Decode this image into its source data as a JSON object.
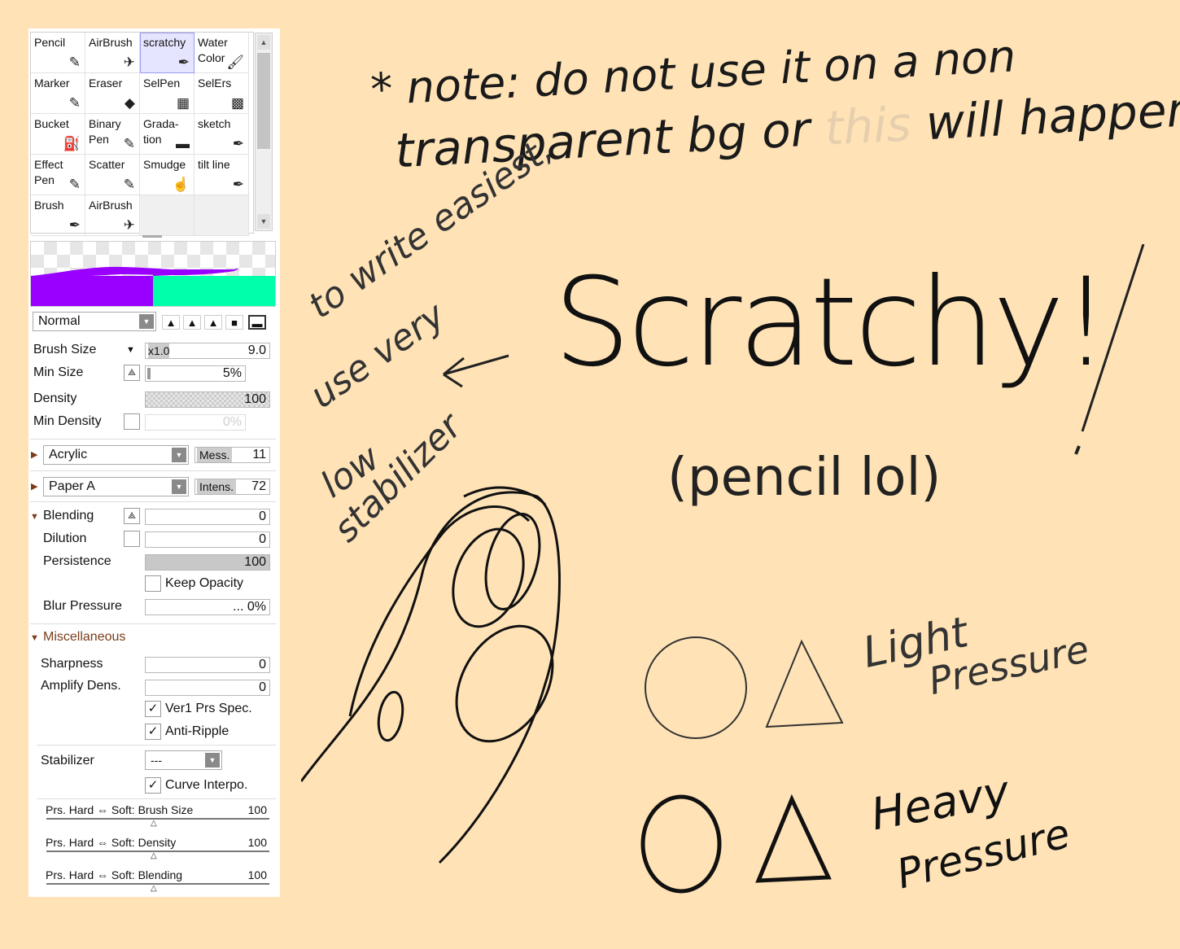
{
  "tools": [
    {
      "name": "Pencil",
      "icon": "pencil"
    },
    {
      "name": "AirBrush",
      "icon": "airbrush"
    },
    {
      "name": "scratchy",
      "icon": "pen",
      "selected": true
    },
    {
      "name": "Water Color",
      "icon": "brush"
    },
    {
      "name": "Marker",
      "icon": "pencil"
    },
    {
      "name": "Eraser",
      "icon": "eraser"
    },
    {
      "name": "SelPen",
      "icon": "selpen"
    },
    {
      "name": "SelErs",
      "icon": "selers"
    },
    {
      "name": "Bucket",
      "icon": "bucket"
    },
    {
      "name": "Binary Pen",
      "icon": "pencil"
    },
    {
      "name": "Grada- tion",
      "icon": "gradient"
    },
    {
      "name": "sketch",
      "icon": "pen"
    },
    {
      "name": "Effect Pen",
      "icon": "pencil"
    },
    {
      "name": "Scatter",
      "icon": "pencil"
    },
    {
      "name": "Smudge",
      "icon": "smudge"
    },
    {
      "name": "tilt line",
      "icon": "pen"
    },
    {
      "name": "Brush",
      "icon": "pen"
    },
    {
      "name": "AirBrush",
      "icon": "airbrush"
    }
  ],
  "blend_mode": "Normal",
  "brush_size": {
    "label": "Brush Size",
    "multiplier": "x1.0",
    "value": "9.0"
  },
  "min_size": {
    "label": "Min Size",
    "value": "5%",
    "fraction": 0.05
  },
  "density": {
    "label": "Density",
    "value": "100"
  },
  "min_density": {
    "label": "Min Density",
    "value": "0%"
  },
  "texture1": {
    "name": "Acrylic",
    "param_label": "Mess.",
    "param_value": "11"
  },
  "texture2": {
    "name": "Paper A",
    "param_label": "Intens.",
    "param_value": "72"
  },
  "blending": {
    "label": "Blending",
    "value": "0"
  },
  "dilution": {
    "label": "Dilution",
    "value": "0"
  },
  "persistence": {
    "label": "Persistence",
    "value": "100"
  },
  "keep_opacity": {
    "label": "Keep Opacity",
    "checked": false
  },
  "blur_pressure": {
    "label": "Blur Pressure",
    "value": "... 0%"
  },
  "misc": {
    "label": "Miscellaneous"
  },
  "sharpness": {
    "label": "Sharpness",
    "value": "0"
  },
  "amplify": {
    "label": "Amplify Dens.",
    "value": "0"
  },
  "ver1": {
    "label": "Ver1 Prs Spec.",
    "checked": true
  },
  "antiripple": {
    "label": "Anti-Ripple",
    "checked": true
  },
  "stabilizer": {
    "label": "Stabilizer",
    "value": "---"
  },
  "curve": {
    "label": "Curve Interpo.",
    "checked": true
  },
  "prs": [
    {
      "label": "Prs. Hard ⇔ Soft: Brush Size",
      "value": "100"
    },
    {
      "label": "Prs. Hard ⇔ Soft: Density",
      "value": "100"
    },
    {
      "label": "Prs. Hard ⇔ Soft: Blending",
      "value": "100"
    }
  ],
  "canvas": {
    "note_line1": "* note: do not use it on a non",
    "note_line2_a": "transparent bg or",
    "note_line2_b": "this",
    "note_line2_c": "will happen!",
    "side_note": [
      "to write easiest,",
      "use very",
      "low",
      "stabilizer"
    ],
    "title": "Scratchy!",
    "subtitle": "(pencil lol)",
    "light": [
      "Light",
      "Pressure"
    ],
    "heavy": [
      "Heavy",
      "Pressure"
    ]
  },
  "colors": {
    "bg": "#ffe3b6",
    "preview_purple": "#9900ff",
    "preview_green": "#00ffaa"
  }
}
